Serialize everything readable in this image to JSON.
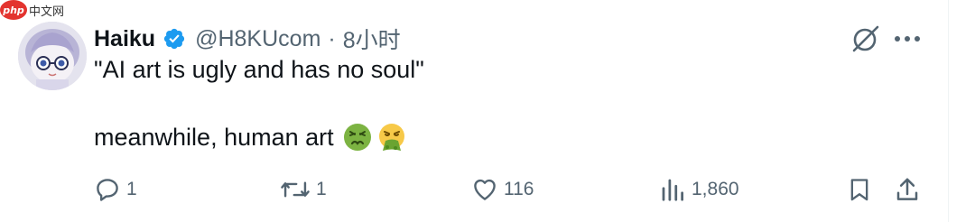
{
  "watermark": {
    "logo_text": "php",
    "site_text": "中文网"
  },
  "tweet": {
    "author_name": "Haiku",
    "handle": "@H8KUcom",
    "separator": "·",
    "time": "8小时",
    "text_line1": "\"AI art is ugly and has no soul\"",
    "text_line2": "meanwhile, human art",
    "emojis": [
      "nauseated-face",
      "face-vomiting"
    ]
  },
  "actions": {
    "reply_count": "1",
    "retweet_count": "1",
    "like_count": "116",
    "views_count": "1,860"
  },
  "colors": {
    "text_primary": "#0f1419",
    "text_secondary": "#536471",
    "verified_blue": "#1d9bf0"
  }
}
